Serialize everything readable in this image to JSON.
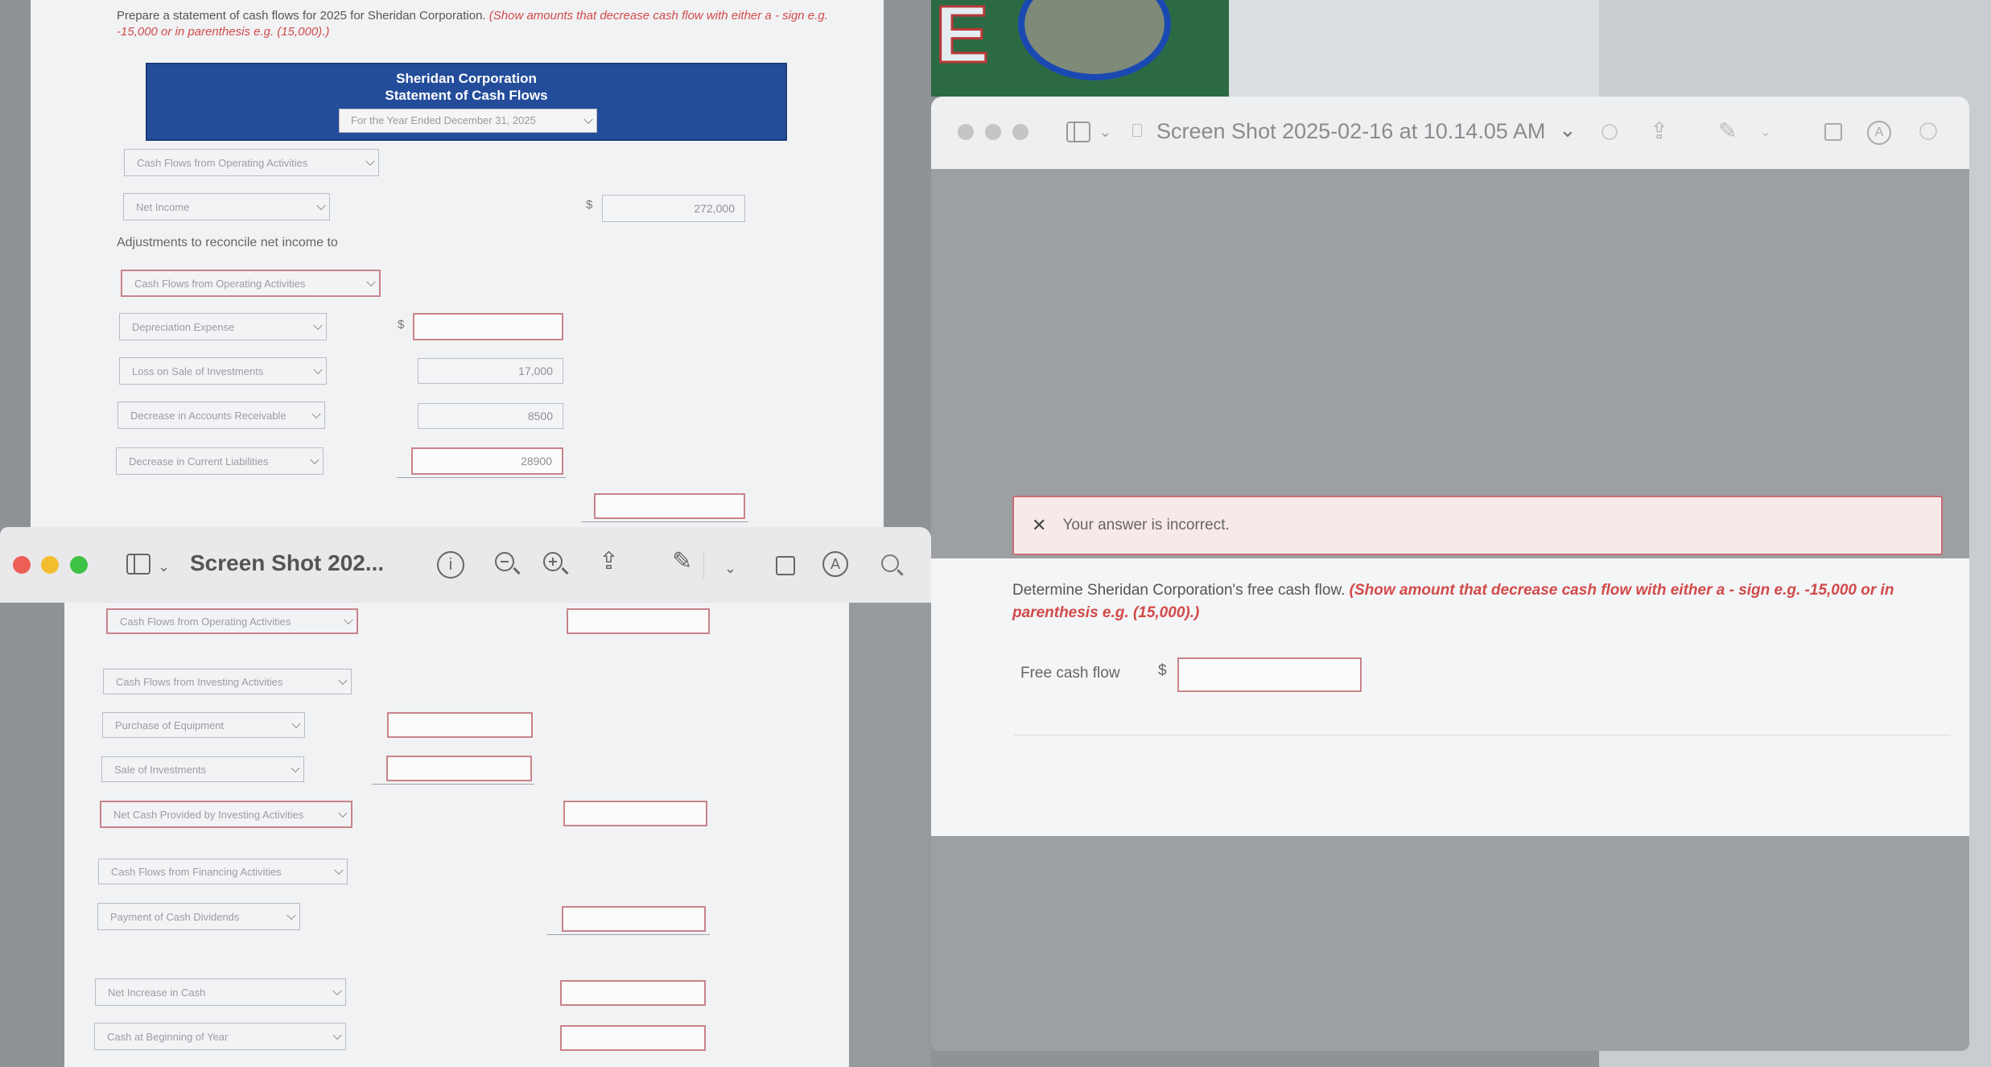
{
  "worksheet": {
    "instructions_line1": "Prepare a statement of cash flows for 2025 for Sheridan Corporation.",
    "instructions_em_line1": "(Show amounts that decrease cash flow with either a - sign e.g.",
    "instructions_em_line2": "-15,000 or in parenthesis e.g. (15,000).)",
    "company_name": "Sheridan Corporation",
    "statement_title": "Statement of Cash Flows",
    "period_select": "For the Year Ended December 31, 2025",
    "operating_header_select": "Cash Flows from Operating Activities",
    "net_income_select": "Net Income",
    "currency_symbol": "$",
    "net_income_value": "272,000",
    "adjustments_label": "Adjustments to reconcile net income to",
    "adjustments_select": "Cash Flows from Operating Activities",
    "adjustments": [
      {
        "label": "Depreciation Expense",
        "value": ""
      },
      {
        "label": "Loss on Sale of Investments",
        "value": "17,000"
      },
      {
        "label": "Decrease in Accounts Receivable",
        "value": "8500"
      },
      {
        "label": "Decrease in Current Liabilities",
        "value": "28900"
      }
    ]
  },
  "viewer_window": {
    "title": "Screen Shot 202...",
    "rows": [
      {
        "label": "Cash Flows from Operating Activities"
      },
      {
        "label": "Cash Flows from Investing Activities"
      },
      {
        "label": "Purchase of Equipment"
      },
      {
        "label": "Sale of Investments"
      },
      {
        "label": "Net Cash Provided by Investing Activities"
      },
      {
        "label": "Cash Flows from Financing Activities"
      },
      {
        "label": "Payment of Cash Dividends"
      },
      {
        "label": "Net Increase in Cash"
      },
      {
        "label": "Cash at Beginning of Year"
      }
    ]
  },
  "preview_window": {
    "title": "Screen Shot 2025-02-16 at 10.14.05 AM",
    "alert_text": "Your answer is incorrect.",
    "question_text": "Determine Sheridan Corporation's free cash flow.",
    "question_em_line1": "(Show amount that decrease cash flow with either a - sign e.g. -15,000 or in",
    "question_em_line2": "parenthesis e.g. (15,000).)",
    "field_label": "Free cash flow",
    "currency_symbol": "$",
    "field_value": ""
  },
  "background": {
    "sign_letter": "E"
  }
}
